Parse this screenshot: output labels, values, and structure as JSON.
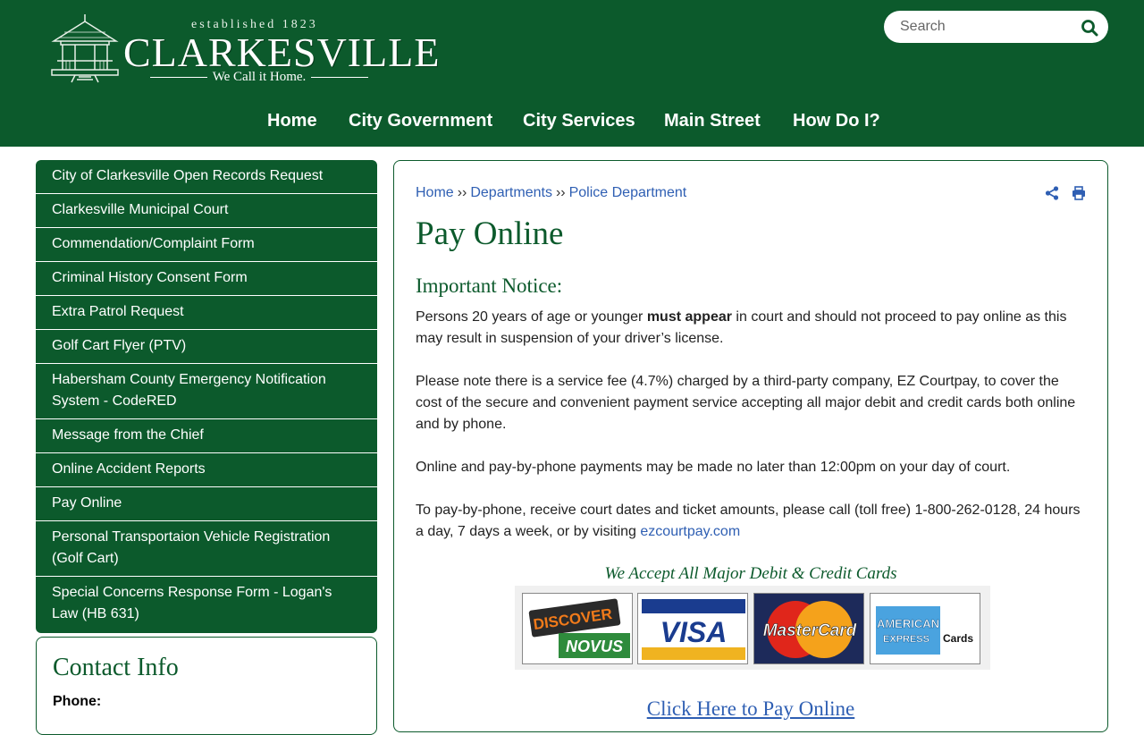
{
  "header": {
    "logo": {
      "established": "established 1823",
      "name": "CLARKESVILLE",
      "tagline": "We Call it Home."
    },
    "search": {
      "placeholder": "Search"
    },
    "nav": [
      "Home",
      "City Government",
      "City Services",
      "Main Street",
      "How Do I?"
    ]
  },
  "sidebar": {
    "items": [
      "City of Clarkesville Open Records Request",
      "Clarkesville Municipal Court",
      "Commendation/Complaint Form",
      "Criminal History Consent Form",
      "Extra Patrol Request",
      "Golf Cart Flyer (PTV)",
      "Habersham County Emergency Notification System - CodeRED",
      "Message from the Chief",
      "Online Accident Reports",
      "Pay Online",
      "Personal Transportaion Vehicle Registration (Golf Cart)",
      "Special Concerns Response Form - Logan's Law (HB 631)"
    ],
    "contact": {
      "title": "Contact Info",
      "phone_label": "Phone:"
    }
  },
  "main": {
    "breadcrumb": [
      "Home",
      "Departments",
      "Police Department"
    ],
    "breadcrumb_sep": "››",
    "title": "Pay Online",
    "notice_heading": "Important Notice:",
    "para1": {
      "before": "Persons 20 years of age or younger ",
      "bold": "must appear",
      "after": " in court and should not proceed to pay online as this may result in suspension of your driver’s license."
    },
    "para2": "Please note there is a service fee (4.7%) charged by a third-party company, EZ Courtpay, to cover the cost of the secure and convenient payment service accepting all major debit and credit cards both online and by phone.",
    "para3": "Online and pay-by-phone payments may be made no later than 12:00pm on your day of court.",
    "para4": {
      "text": "To pay-by-phone, receive court dates and ticket amounts, please call (toll free) 1-800-262-0128, 24 hours a day, 7 days a week, or by visiting ",
      "link": "ezcourtpay.com"
    },
    "cards_heading": "We Accept All Major Debit & Credit Cards",
    "cards": {
      "discover": [
        "DISCOVER",
        "NOVUS"
      ],
      "visa": "VISA",
      "mastercard": "MasterCard",
      "amex": [
        "AMERICAN",
        "EXPRESS",
        "Cards"
      ]
    },
    "pay_link": "Click Here to Pay Online"
  },
  "colors": {
    "brand_green": "#0c5a2c",
    "link_blue": "#2f5fb3"
  }
}
